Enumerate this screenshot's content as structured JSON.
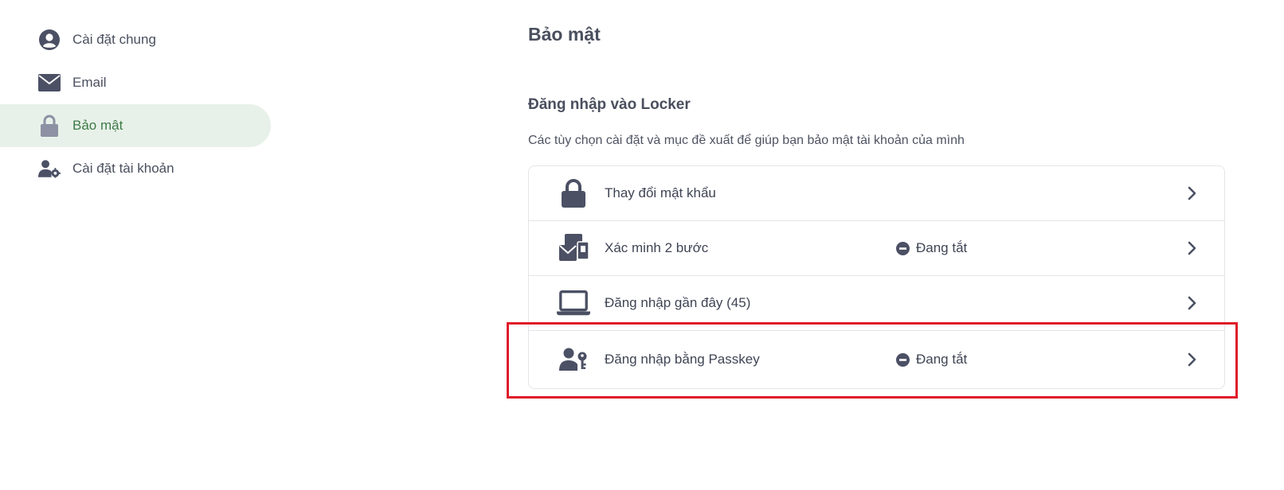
{
  "sidebar": {
    "items": [
      {
        "label": "Cài đặt chung",
        "icon": "user-circle-icon",
        "active": false
      },
      {
        "label": "Email",
        "icon": "envelope-icon",
        "active": false
      },
      {
        "label": "Bảo mật",
        "icon": "lock-icon",
        "active": true
      },
      {
        "label": "Cài đặt tài khoản",
        "icon": "user-gear-icon",
        "active": false
      }
    ]
  },
  "main": {
    "title": "Bảo mật",
    "section_title": "Đăng nhập vào Locker",
    "section_desc": "Các tùy chọn cài đặt và mục đề xuất để giúp bạn bảo mật tài khoản của mình",
    "rows": [
      {
        "label": "Thay đổi mật khẩu",
        "icon": "lock-icon",
        "status": ""
      },
      {
        "label": "Xác minh 2 bước",
        "icon": "two-step-verification-icon",
        "status": "Đang tắt"
      },
      {
        "label": "Đăng nhập gần đây (45)",
        "icon": "laptop-icon",
        "status": ""
      },
      {
        "label": "Đăng nhập bằng Passkey",
        "icon": "user-key-icon",
        "status": "Đang tắt"
      }
    ]
  },
  "colors": {
    "active_bg": "#e8f1e9",
    "active_text": "#3e7a48",
    "icon": "#4b5064",
    "highlight_border": "#e01b2a"
  }
}
